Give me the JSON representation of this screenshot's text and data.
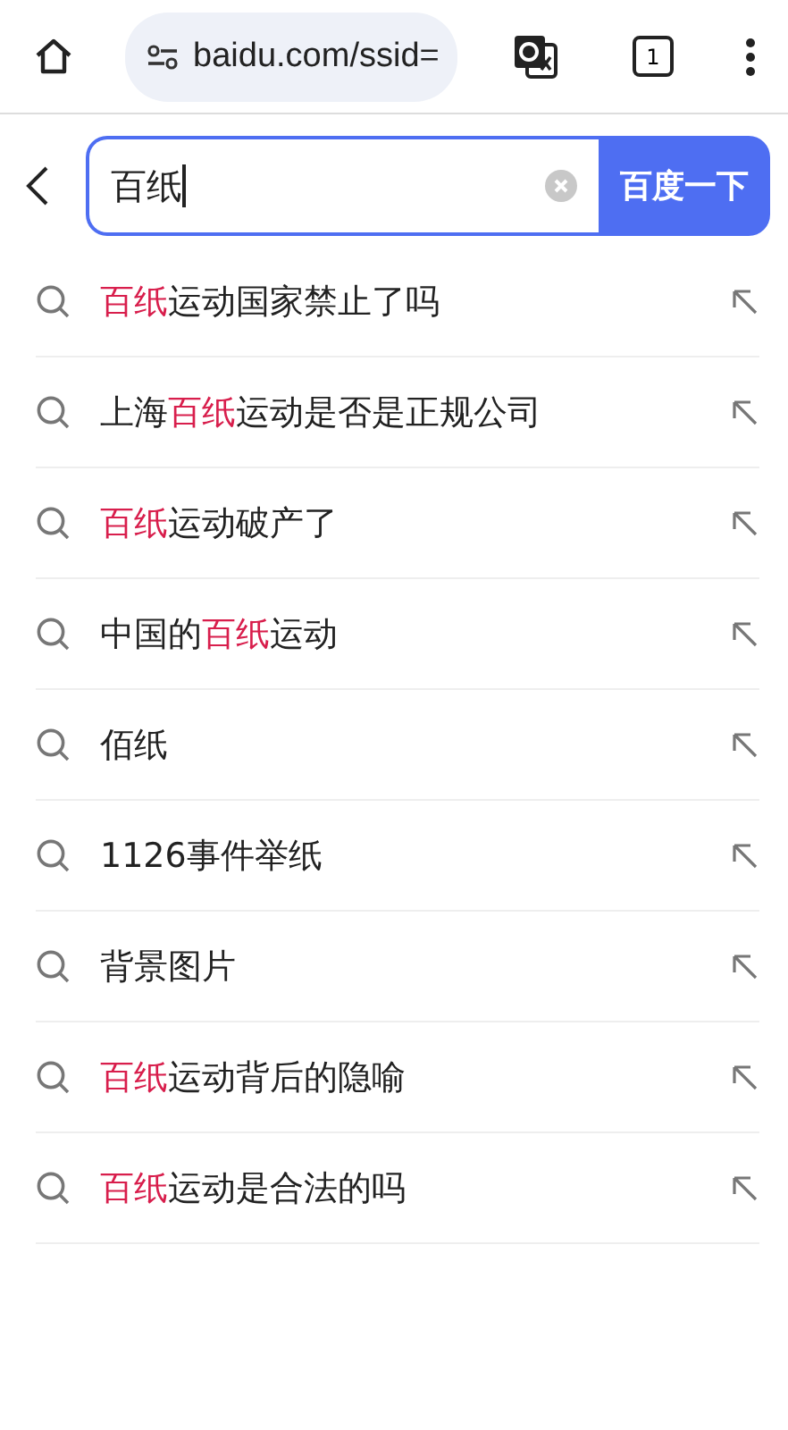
{
  "browser_bar": {
    "url": "baidu.com/ssid=",
    "tab_count": "1"
  },
  "search": {
    "value": "百纸",
    "button": "百度一下"
  },
  "suggestions": [
    [
      {
        "text": "百纸",
        "highlight": true
      },
      {
        "text": "运动国家禁止了吗",
        "highlight": false
      }
    ],
    [
      {
        "text": "上海",
        "highlight": false
      },
      {
        "text": "百纸",
        "highlight": true
      },
      {
        "text": "运动是否是正规公司",
        "highlight": false
      }
    ],
    [
      {
        "text": "百纸",
        "highlight": true
      },
      {
        "text": "运动破产了",
        "highlight": false
      }
    ],
    [
      {
        "text": "中国的",
        "highlight": false
      },
      {
        "text": "百纸",
        "highlight": true
      },
      {
        "text": "运动",
        "highlight": false
      }
    ],
    [
      {
        "text": "佰纸",
        "highlight": false
      }
    ],
    [
      {
        "text": "1126事件举纸",
        "highlight": false
      }
    ],
    [
      {
        "text": "背景图片",
        "highlight": false
      }
    ],
    [
      {
        "text": "百纸",
        "highlight": true
      },
      {
        "text": "运动背后的隐喻",
        "highlight": false
      }
    ],
    [
      {
        "text": "百纸",
        "highlight": true
      },
      {
        "text": "运动是合法的吗",
        "highlight": false
      }
    ]
  ]
}
